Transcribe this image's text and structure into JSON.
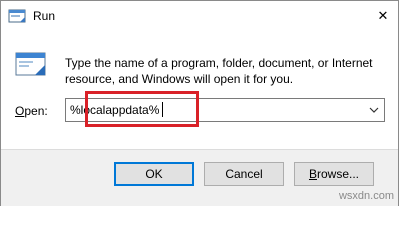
{
  "window": {
    "title": "Run",
    "close_glyph": "✕"
  },
  "content": {
    "instructions": "Type the name of a program, folder, document, or Internet resource, and Windows will open it for you."
  },
  "open": {
    "label_hotkey": "O",
    "label_rest": "pen:",
    "value": "%localappdata%"
  },
  "buttons": {
    "ok": "OK",
    "cancel": "Cancel",
    "browse_hotkey": "B",
    "browse_rest": "rowse..."
  },
  "watermark": "wsxdn.com",
  "colors": {
    "highlight": "#d92128",
    "accent": "#0078d7"
  }
}
